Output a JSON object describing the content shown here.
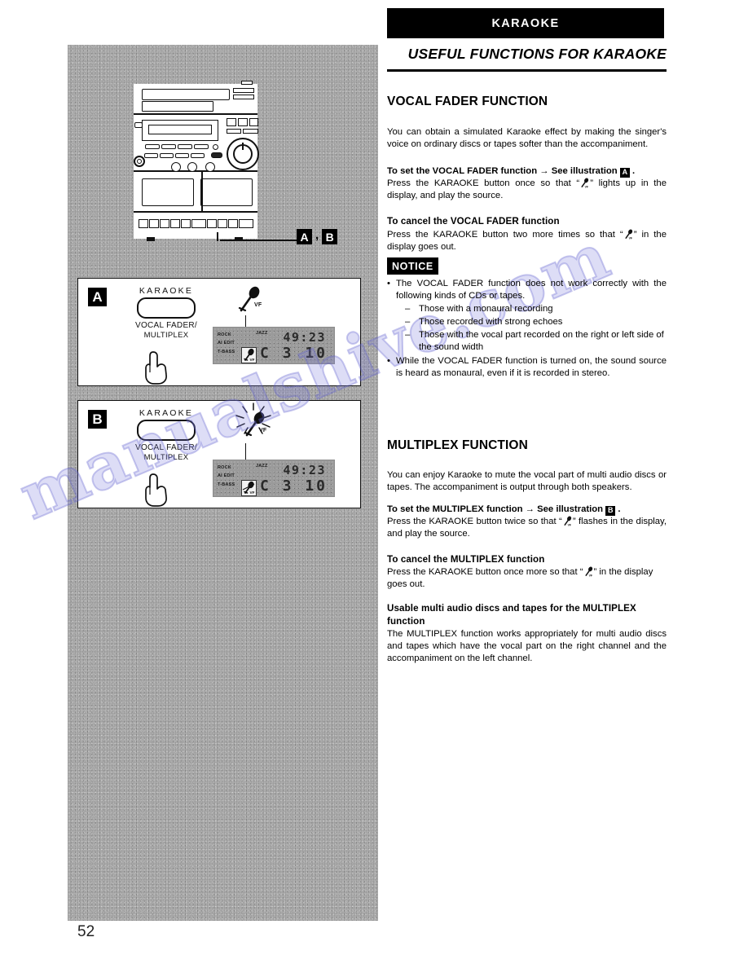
{
  "page": {
    "number": "52",
    "watermark": "manualshive.com"
  },
  "header": {
    "banner": "KARAOKE",
    "subtitle": "USEFUL FUNCTIONS FOR KARAOKE"
  },
  "device_callout": {
    "badge_a": "A",
    "separator": ",",
    "badge_b": "B"
  },
  "illustrations": [
    {
      "badge": "A",
      "button_top_label": "KARAOKE",
      "button_sub_line1": "VOCAL FADER/",
      "button_sub_line2": "MULTIPLEX",
      "mic_label": "VF",
      "display": {
        "label_rock": "ROCK",
        "label_jazz": "JAZZ",
        "label_ai_edit": "AI EDIT",
        "label_t_bass": "T-BASS",
        "indicator": "VF",
        "segment_top": "49:23",
        "segment_bottom": "C 3 10"
      },
      "state": "lit"
    },
    {
      "badge": "B",
      "button_top_label": "KARAOKE",
      "button_sub_line1": "VOCAL FADER/",
      "button_sub_line2": "MULTIPLEX",
      "mic_label": "VF",
      "display": {
        "label_rock": "ROCK",
        "label_jazz": "JAZZ",
        "label_ai_edit": "AI EDIT",
        "label_t_bass": "T-BASS",
        "indicator": "VF",
        "segment_top": "49:23",
        "segment_bottom": "C 3 10"
      },
      "state": "flashing"
    }
  ],
  "vocal_fader": {
    "title": "VOCAL FADER FUNCTION",
    "intro": "You can obtain a simulated Karaoke effect by  making the singer's voice on ordinary discs or tapes softer than the accompaniment.",
    "set_heading_pre": "To set the VOCAL FADER function",
    "set_heading_arrow": "→",
    "set_heading_post": "See illustration",
    "set_heading_badge": "A",
    "set_heading_period": ".",
    "set_body_pre": "Press the KARAOKE button once so that “",
    "set_body_post": "” lights up in the display, and play the source.",
    "cancel_heading": "To cancel the VOCAL FADER function",
    "cancel_body_pre": "Press the KARAOKE button two more times so that “",
    "cancel_body_post": "” in the display goes out."
  },
  "notice": {
    "label": "NOTICE",
    "bullet1": "The VOCAL FADER function does not work correctly with the following kinds of CDs or tapes.",
    "dashes": [
      "Those with a monaural recording",
      "Those recorded with strong echoes",
      "Those with the vocal part recorded on the right or left side of the sound width"
    ],
    "bullet2": "While the VOCAL FADER function is turned on, the sound source is heard as monaural, even if it is recorded in stereo.",
    "bullet_char": "•",
    "dash_char": "–"
  },
  "multiplex": {
    "title": "MULTIPLEX FUNCTION",
    "intro": "You can enjoy Karaoke to mute the vocal part of multi audio discs or tapes.  The accompaniment is output through both speakers.",
    "set_heading_pre": "To set the MULTIPLEX function",
    "set_heading_arrow": "→",
    "set_heading_post": "See illustration",
    "set_heading_badge": "B",
    "set_heading_period": ".",
    "set_body_pre": "Press the KARAOKE button twice so that “",
    "set_body_post": "” flashes in the display, and play the source.",
    "cancel_heading": "To cancel the MULTIPLEX function",
    "cancel_body_pre": "Press the KARAOKE button once more so that “",
    "cancel_body_post": "” in the display goes out.",
    "usable_heading_line1": "Usable  multi  audio  discs  and  tapes  for  the  MULTIPLEX",
    "usable_heading_line2": "function",
    "usable_body": "The MULTIPLEX function works appropriately for multi audio discs and  tapes which have the vocal part on the right channel and the accompaniment on the left channel."
  },
  "colors": {
    "ink": "#000000",
    "scan_grey": "#a9a9a9",
    "lcd_grey": "#9a9a9a",
    "watermark": "#5f5fcd"
  }
}
